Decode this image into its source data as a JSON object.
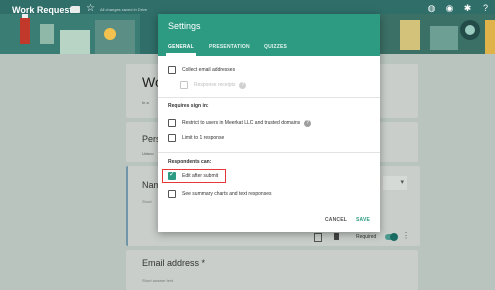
{
  "header": {
    "title": "Work Request",
    "saved_text": "All changes saved in Drive"
  },
  "background_form": {
    "title": "Wo",
    "subtitle": "In a",
    "question1": "Perso",
    "question1_sub": "Unkno",
    "question2": "Nam",
    "question2_hint": "Short",
    "dropdown_arrow": "▾",
    "required_label": "Required",
    "more_icon": "⋮",
    "question3": "Email address *",
    "question3_hint": "Short answer text"
  },
  "dialog": {
    "title": "Settings",
    "tabs": [
      {
        "label": "GENERAL",
        "active": true
      },
      {
        "label": "PRESENTATION",
        "active": false
      },
      {
        "label": "QUIZZES",
        "active": false
      }
    ],
    "collect_email": {
      "label": "Collect email addresses",
      "checked": false
    },
    "response_receipts": {
      "label": "Response receipts",
      "checked": false,
      "disabled": true
    },
    "requires_sign_in": "Requires sign in:",
    "restrict_users": {
      "label": "Restrict to users in Meerkat LLC and trusted domains",
      "checked": false
    },
    "limit_one": {
      "label": "Limit to 1 response",
      "checked": false
    },
    "respondents_can": "Respondents can:",
    "edit_after_submit": {
      "label": "Edit after submit",
      "checked": true
    },
    "see_summary": {
      "label": "See summary charts and text responses",
      "checked": false
    },
    "cancel_label": "CANCEL",
    "save_label": "SAVE",
    "help_glyph": "?"
  },
  "colors": {
    "accent": "#2d9b82",
    "header_bg": "#2f6e69",
    "highlight": "#e53935"
  },
  "icons": [
    "folder-icon",
    "star-icon",
    "palette-icon",
    "preview-eye-icon",
    "settings-gear-icon",
    "help-icon",
    "copy-icon",
    "trash-icon",
    "more-vert-icon"
  ]
}
